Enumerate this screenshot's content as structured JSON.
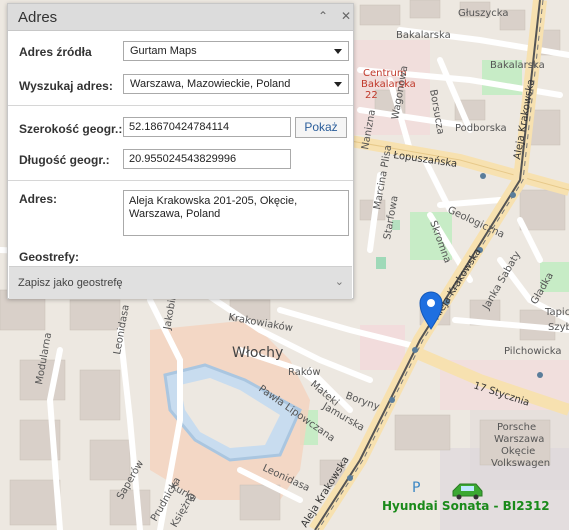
{
  "panel": {
    "title": "Adres",
    "collapse_icon": "double-chevron-up-icon",
    "close_icon": "close-icon",
    "source_label": "Adres źródła",
    "source_value": "Gurtam Maps",
    "search_label": "Wyszukaj adres:",
    "search_value": "Warszawa, Mazowieckie, Poland",
    "lat_label": "Szerokość geogr.:",
    "lat_value": "52.18670424784114",
    "show_button": "Pokaż",
    "lon_label": "Długość geogr.:",
    "lon_value": "20.955024543829996",
    "address_label": "Adres:",
    "address_value": "Aleja Krakowska 201-205, Okęcie,\nWarszawa, Poland",
    "geofences_label": "Geostrefy:",
    "save_geofence": "Zapisz jako geostrefę"
  },
  "map": {
    "labels": {
      "gluszycka": "Głuszycka",
      "bakalarska1": "Bakalarska",
      "bakalarska2": "Bakalarska",
      "centrum1": "Centrum",
      "centrum2": "Bakalarska",
      "centrum3": "22",
      "borsucza": "Borsucza",
      "wagonowa": "Wagonowa",
      "podborska": "Podborska",
      "nanizna": "Nanizna",
      "lopuszanska": "Łopuszańska",
      "aleja_krakowska_n": "Aleja Krakowska",
      "marcina_plisa": "Marcina Plisa",
      "geologiczna": "Geologiczna",
      "starfowa": "Starfowa",
      "skromna": "Skromna",
      "aleja_krakowska_mid": "Aleja Krakowska",
      "janka_sabaty": "Janka Sabaty",
      "gladka": "Gładka",
      "tapicerska": "Tapicerskie",
      "szybka": "Szybka",
      "pilchowicka": "Pilchowicka",
      "krakowiakow": "Krakowiaków",
      "jakobinow": "Jakobinów",
      "leonidasa": "Leonidasa",
      "wlochy": "Włochy",
      "rakow": "Raków",
      "boryny": "Boryny",
      "mateki": "Mateki",
      "jamurska": "Jamurska",
      "pawla_lipowczana": "Pawła Lipowczana",
      "modularna": "Modularna",
      "17_stycznia": "17 Stycznia",
      "porsche1": "Porsche",
      "porsche2": "Warszawa",
      "porsche3": "Okęcie",
      "porsche4": "Volkswagen",
      "leonidasa2": "Leonidasa",
      "aleja_krakowska_s": "Aleja Krakowska",
      "kurka": "Kurka",
      "sapera": "Saperów",
      "prudnicka": "Prudnicka",
      "ksiezna": "Księżna"
    },
    "parking": "P",
    "vehicle": "Hyundai Sonata - BI2312",
    "marker_icon": "map-pin-icon",
    "vehicle_icon": "car-icon"
  }
}
